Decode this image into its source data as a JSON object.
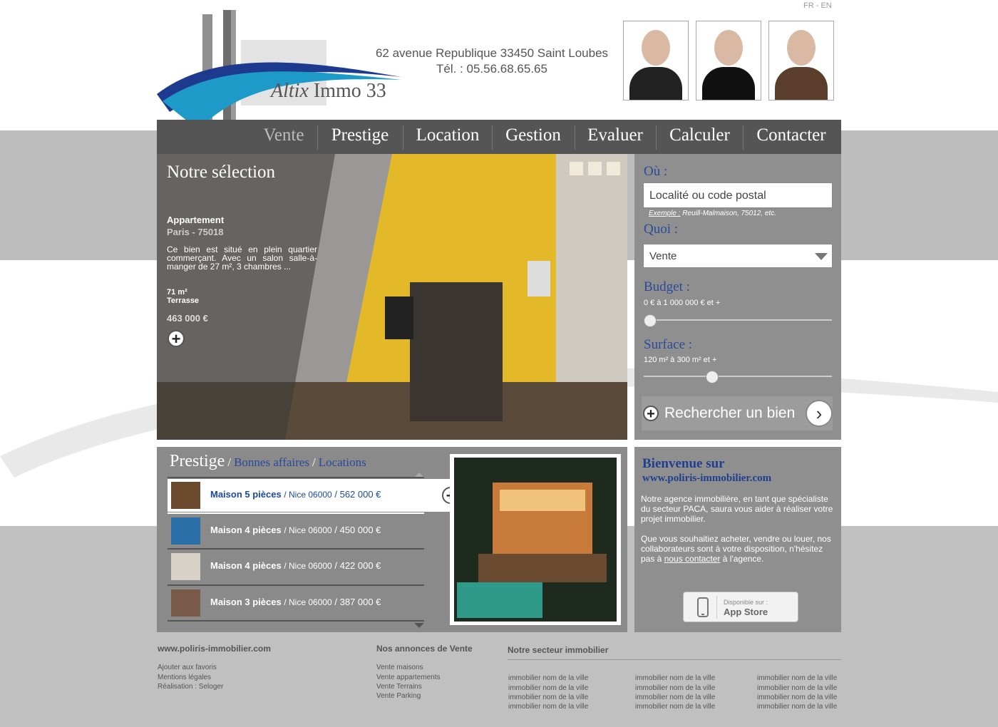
{
  "lang": {
    "fr": "FR",
    "sep": "-",
    "en": "EN"
  },
  "logo": {
    "brand": "Altix",
    "name": "Immo 33"
  },
  "contact": {
    "address": "62 avenue Republique 33450 Saint Loubes",
    "phone": "Tél. : 05.56.68.65.65"
  },
  "nav": {
    "items": [
      "Vente",
      "Prestige",
      "Location",
      "Gestion",
      "Evaluer",
      "Calculer",
      "Contacter"
    ],
    "active": "Vente"
  },
  "hero": {
    "title": "Notre sélection",
    "type": "Appartement",
    "city": "Paris - 75018",
    "desc": "Ce bien est situé en plein quartier commerçant. Avec un salon salle-à-manger de 27 m², 3 chambres ...",
    "area": "71 m²",
    "feature": "Terrasse",
    "price": "463 000 €",
    "more": "+"
  },
  "search": {
    "where_label": "Où :",
    "where_placeholder": "Localité ou code postal",
    "example_label": "Exemple :",
    "example_text": "Reuill-Malmaison, 75012, etc.",
    "what_label": "Quoi :",
    "what_value": "Vente",
    "budget_label": "Budget :",
    "budget_range": "0 € à 1 000 000 € et +",
    "surface_label": "Surface :",
    "surface_range": "120 m² à 300 m² et +",
    "submit": "Rechercher un bien",
    "budget_level": 0.0,
    "surface_level": 0.35
  },
  "listings": {
    "tab_main": "Prestige",
    "tab_sep": "/",
    "tab_2": "Bonnes affaires",
    "tab_3": "Locations",
    "rows": [
      {
        "title": "Maison 5 pièces",
        "city": "/ Nice 06000",
        "price": "/ 562 000 €"
      },
      {
        "title": "Maison 4 pièces",
        "city": "/ Nice 06000",
        "price": "/ 450 000 €"
      },
      {
        "title": "Maison 4 pièces",
        "city": "/ Nice 06000",
        "price": "/ 422 000 €"
      },
      {
        "title": "Maison 3 pièces",
        "city": "/ Nice 06000",
        "price": "/ 387 000 €"
      }
    ]
  },
  "welcome": {
    "title": "Bienvenue sur",
    "url": "www.poliris-immobilier.com",
    "p1": "Notre agence immobilière, en tant que spécialiste du secteur PACA, saura vous aider à réaliser votre projet immobilier.",
    "p2_before": "Que vous souhaitiez acheter, vendre ou louer, nos collaborateurs sont à votre disposition, n'hésitez pas à ",
    "p2_link": "nous contacter",
    "p2_after": " à l'agence.",
    "app_small": "Disponible sur :",
    "app_big": "App Store"
  },
  "footer": {
    "col1_head": "www.poliris-immobilier.com",
    "col1_links": [
      "Ajouter aux favoris",
      "Mentions légales",
      "Réalisation : Seloger"
    ],
    "col2_head": "Nos annonces de Vente",
    "col2_links": [
      "Vente maisons",
      "Vente appartements",
      "Vente Terrains",
      "Vente Parking"
    ],
    "col3_head": "Notre secteur immobilier",
    "city_links": [
      "immobilier nom de la ville",
      "immobilier nom de la ville",
      "immobilier nom de la ville",
      "immobilier nom de la ville"
    ]
  },
  "colors": {
    "accent_blue": "#2a4a9a",
    "nav_bg": "#555555",
    "panel_grey": "#8f8f8f"
  }
}
